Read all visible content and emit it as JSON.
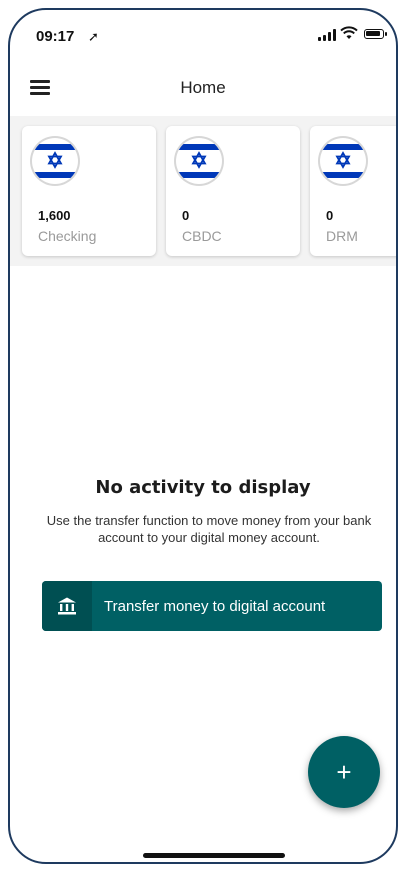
{
  "status_bar": {
    "time": "09:17",
    "location_icon": "location-arrow-icon",
    "signal_icon": "signal-icon",
    "wifi_icon": "wifi-icon",
    "battery_icon": "battery-icon"
  },
  "header": {
    "menu_icon": "hamburger-menu-icon",
    "title": "Home"
  },
  "accounts": [
    {
      "value": "1,600",
      "label": "Checking",
      "icon": "israel-flag-icon"
    },
    {
      "value": "0",
      "label": "CBDC",
      "icon": "israel-flag-icon"
    },
    {
      "value": "0",
      "label": "DRM",
      "icon": "israel-flag-icon"
    }
  ],
  "empty_state": {
    "title": "No activity to display",
    "description": "Use the transfer function to move money from your bank account to your digital money account."
  },
  "transfer_button": {
    "icon": "bank-icon",
    "label": "Transfer money to digital account"
  },
  "fab": {
    "icon": "plus-icon",
    "label": "+"
  },
  "colors": {
    "primary": "#006064",
    "primary_dark": "#004f52",
    "flag_blue": "#0038b8",
    "card_strip_bg": "#f3f3f3"
  }
}
